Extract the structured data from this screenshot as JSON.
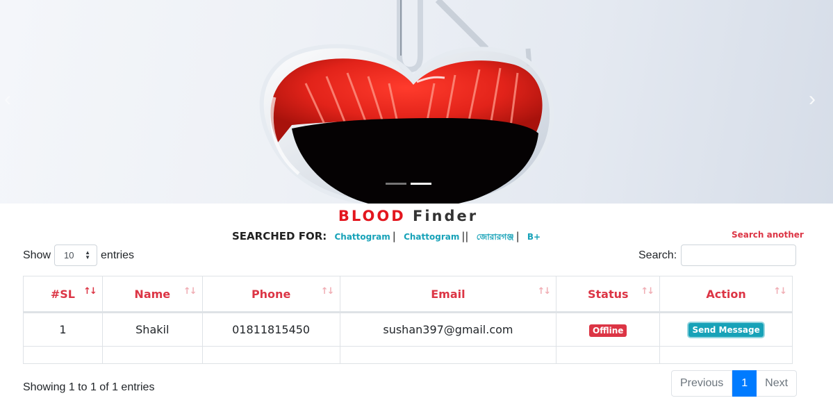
{
  "carousel": {
    "prev_icon": "chevron-left-icon",
    "next_icon": "chevron-right-icon",
    "slide_count": 2,
    "active_slide": 2
  },
  "title": {
    "part1": "BLOOD",
    "part2": "Finder"
  },
  "searched_for": {
    "label": "SEARCHED FOR:",
    "terms": [
      "Chattogram",
      "Chattogram",
      "জোরারগঞ্জ",
      "B+"
    ]
  },
  "search_another": "Search another",
  "controls": {
    "show_label": "Show",
    "entries_value": "10",
    "entries_label": "entries",
    "search_label": "Search:"
  },
  "table": {
    "headers": [
      "#SL",
      "Name",
      "Phone",
      "Email",
      "Status",
      "Action"
    ],
    "rows": [
      {
        "sl": "1",
        "name": "Shakil",
        "phone": "01811815450",
        "email": "sushan397@gmail.com",
        "status": "Offline",
        "action": "Send Message"
      }
    ]
  },
  "footer": {
    "showing": "Showing 1 to 1 of 1 entries",
    "prev": "Previous",
    "page": "1",
    "next": "Next"
  },
  "colors": {
    "accent_red": "#dc3545",
    "info": "#17a2b8",
    "primary": "#007bff"
  }
}
